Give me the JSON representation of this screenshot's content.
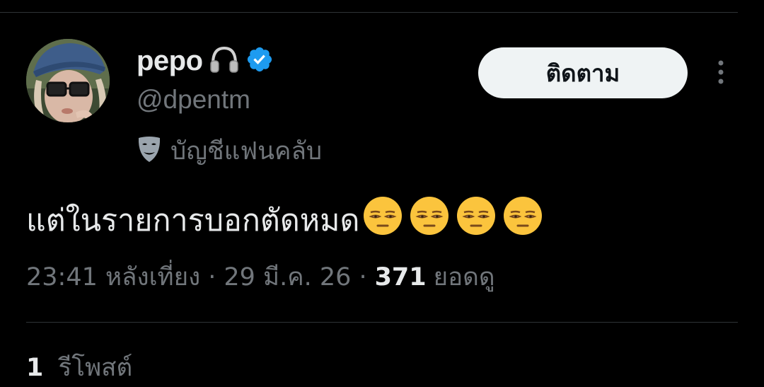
{
  "profile": {
    "display_name": "pepo",
    "name_emoji": "headphone-icon",
    "verified_badge": "verified-badge-icon",
    "handle": "@dpentm",
    "fan_account_icon": "mask-icon",
    "fan_account_label": "บัญชีแฟนคลับ"
  },
  "follow_button": {
    "label": "ติดตาม"
  },
  "more_button": {
    "icon": "more-vertical-icon"
  },
  "tweet": {
    "text": "แต่ในรายการบอกตัดหมด",
    "emojis": [
      "relieved-face-icon",
      "relieved-face-icon",
      "relieved-face-icon",
      "relieved-face-icon"
    ]
  },
  "meta": {
    "time": "23:41 หลังเที่ยง",
    "separator": "·",
    "date": "29 มี.ค. 26",
    "views_count": "371",
    "views_label": "ยอดดู"
  },
  "engagement": {
    "retweets_count": "1",
    "retweets_label": "รีโพสต์"
  },
  "colors": {
    "background": "#000000",
    "primary_text": "#e7e9ea",
    "secondary_text": "#71767b",
    "verified_blue": "#1d9bf0",
    "button_bg": "#eff3f4",
    "divider": "#2f3336"
  }
}
